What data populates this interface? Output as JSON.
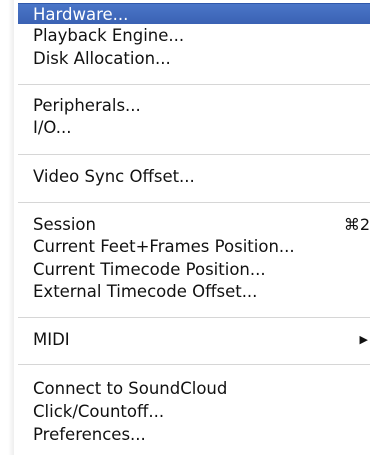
{
  "menu": {
    "items": [
      {
        "label": "Hardware..."
      },
      {
        "label": "Playback Engine..."
      },
      {
        "label": "Disk Allocation..."
      },
      {
        "label": "Peripherals..."
      },
      {
        "label": "I/O..."
      },
      {
        "label": "Video Sync Offset..."
      },
      {
        "label": "Session",
        "shortcut": "⌘2"
      },
      {
        "label": "Current Feet+Frames Position..."
      },
      {
        "label": "Current Timecode Position..."
      },
      {
        "label": "External Timecode Offset..."
      },
      {
        "label": "MIDI",
        "submenu_arrow": "▶"
      },
      {
        "label": "Connect to SoundCloud"
      },
      {
        "label": "Click/Countoff..."
      },
      {
        "label": "Preferences..."
      }
    ],
    "selected_item": "Hardware...",
    "highlight_color": "#3d67bc"
  }
}
